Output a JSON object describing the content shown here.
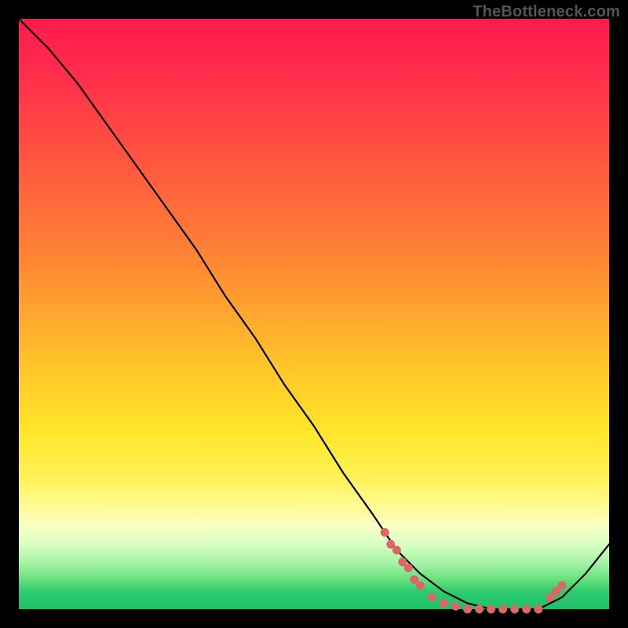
{
  "watermark": "TheBottleneck.com",
  "chart_data": {
    "type": "line",
    "title": "",
    "xlabel": "",
    "ylabel": "",
    "xlim": [
      0,
      100
    ],
    "ylim": [
      0,
      100
    ],
    "grid": false,
    "legend": false,
    "series": [
      {
        "name": "curve",
        "color": "#000000",
        "x": [
          0,
          5,
          10,
          15,
          20,
          25,
          30,
          35,
          40,
          45,
          50,
          55,
          60,
          64,
          68,
          72,
          76,
          80,
          84,
          88,
          92,
          96,
          100
        ],
        "y": [
          100,
          95,
          89,
          82,
          75,
          68,
          61,
          53,
          46,
          38,
          31,
          23,
          16,
          10,
          6,
          3,
          1,
          0,
          0,
          0,
          2,
          6,
          11
        ]
      }
    ],
    "markers": [
      {
        "x": 62,
        "y": 13,
        "color": "#d66"
      },
      {
        "x": 63,
        "y": 11,
        "color": "#d66"
      },
      {
        "x": 64,
        "y": 10,
        "color": "#d66"
      },
      {
        "x": 65,
        "y": 8,
        "color": "#d66"
      },
      {
        "x": 66,
        "y": 7,
        "color": "#d66"
      },
      {
        "x": 67,
        "y": 5,
        "color": "#d66"
      },
      {
        "x": 68,
        "y": 4,
        "color": "#d66"
      },
      {
        "x": 70,
        "y": 2,
        "color": "#d66"
      },
      {
        "x": 72,
        "y": 1,
        "color": "#d66"
      },
      {
        "x": 74,
        "y": 0.5,
        "color": "#d66"
      },
      {
        "x": 76,
        "y": 0,
        "color": "#d66"
      },
      {
        "x": 78,
        "y": 0,
        "color": "#d66"
      },
      {
        "x": 80,
        "y": 0,
        "color": "#d66"
      },
      {
        "x": 82,
        "y": 0,
        "color": "#d66"
      },
      {
        "x": 84,
        "y": 0,
        "color": "#d66"
      },
      {
        "x": 86,
        "y": 0,
        "color": "#d66"
      },
      {
        "x": 88,
        "y": 0,
        "color": "#d66"
      },
      {
        "x": 90,
        "y": 2,
        "color": "#d66"
      },
      {
        "x": 91,
        "y": 3,
        "color": "#d66"
      },
      {
        "x": 92,
        "y": 4,
        "color": "#d66"
      }
    ]
  }
}
